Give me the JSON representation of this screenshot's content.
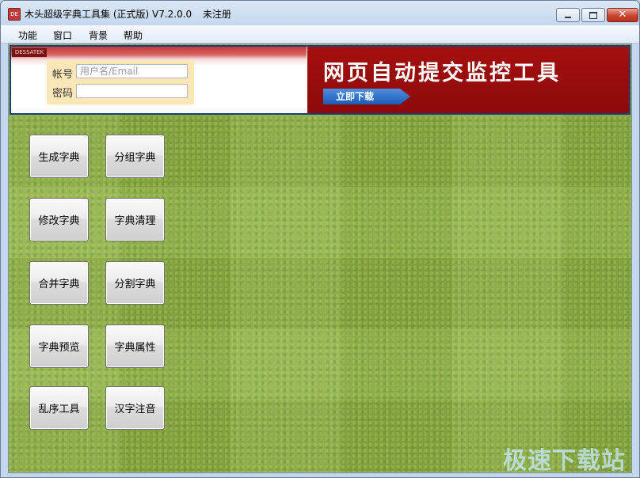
{
  "window": {
    "title": "木头超级字典工具集 (正式版) V7.2.0.0",
    "registration": "未注册",
    "controls": {
      "minimize": "minimize",
      "maximize": "maximize",
      "close": "close"
    }
  },
  "menu": [
    "功能",
    "窗口",
    "背景",
    "帮助"
  ],
  "banner": {
    "login": {
      "account_label": "帐号",
      "account_placeholder": "用户名/Email",
      "account_value": "",
      "password_label": "密码",
      "password_value": ""
    },
    "ad": {
      "title": "网页自动提交监控工具",
      "button": "立即下载"
    }
  },
  "tools": [
    [
      "生成字典",
      "分组字典"
    ],
    [
      "修改字典",
      "字典清理"
    ],
    [
      "合并字典",
      "分割字典"
    ],
    [
      "字典预览",
      "字典属性"
    ],
    [
      "乱序工具",
      "汉字注音"
    ]
  ],
  "watermark": "极速下载站",
  "colors": {
    "banner_red": "#a50f0f",
    "grass_green": "#8fb048",
    "close_button": "#c84531"
  }
}
